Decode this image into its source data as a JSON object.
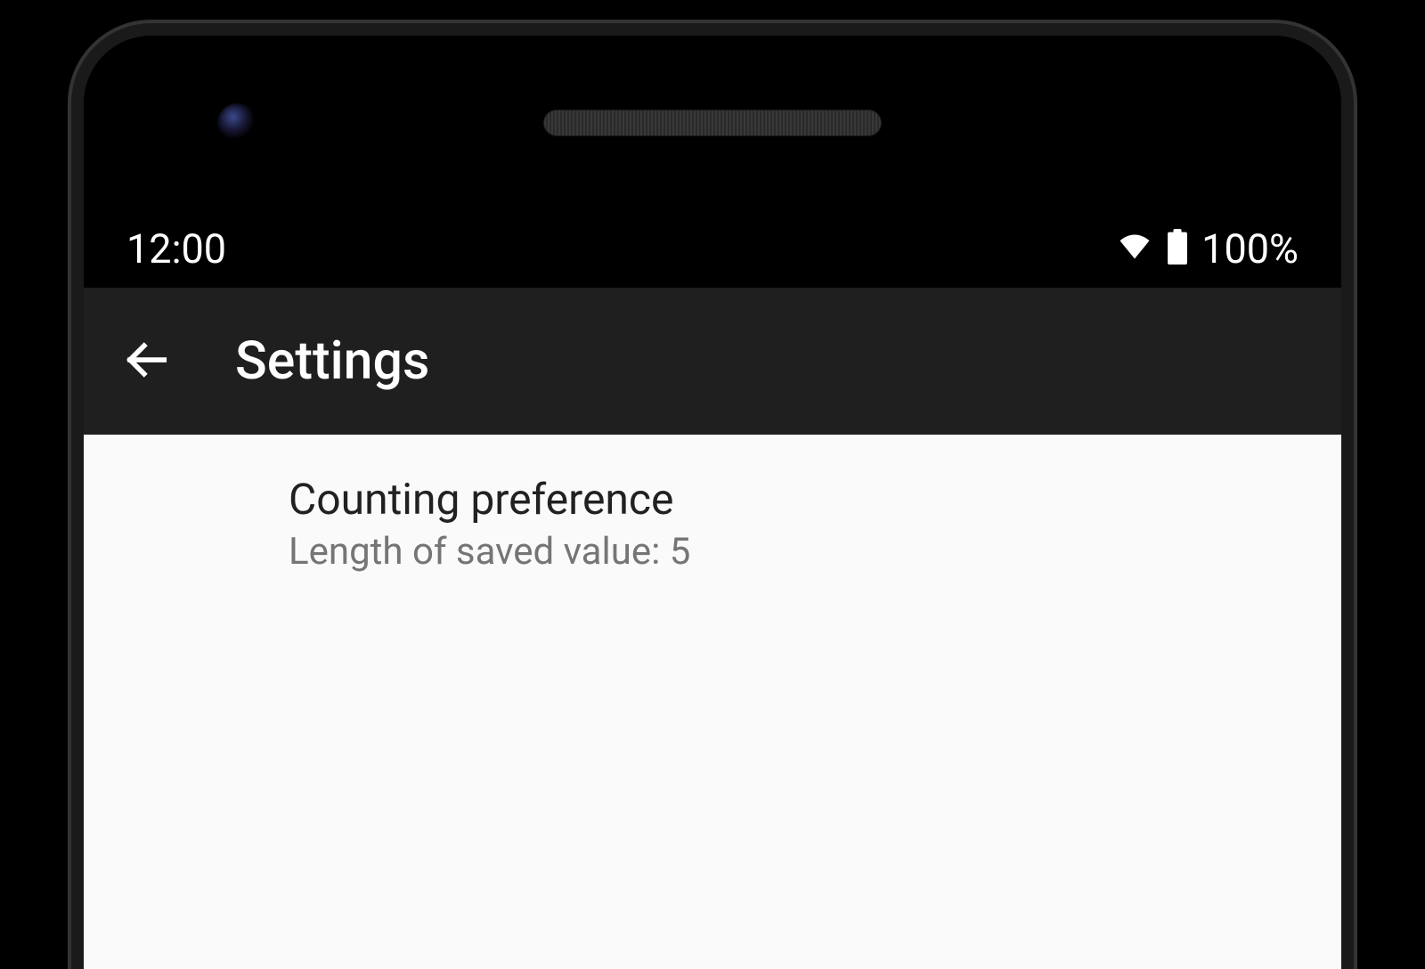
{
  "status_bar": {
    "time": "12:00",
    "battery_percent": "100%"
  },
  "app_bar": {
    "title": "Settings"
  },
  "preferences": {
    "counting": {
      "title": "Counting preference",
      "summary": "Length of saved value: 5"
    }
  }
}
